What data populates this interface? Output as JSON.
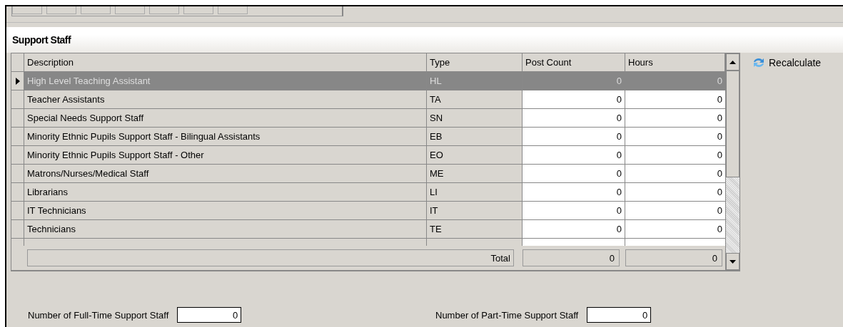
{
  "section": {
    "title": "Support Staff"
  },
  "grid": {
    "columns": [
      "Description",
      "Type",
      "Post Count",
      "Hours"
    ],
    "rows": [
      {
        "description": "High Level Teaching Assistant",
        "type": "HL",
        "post_count": "0",
        "hours": "0",
        "selected": true
      },
      {
        "description": "Teacher Assistants",
        "type": "TA",
        "post_count": "0",
        "hours": "0",
        "selected": false
      },
      {
        "description": "Special Needs Support Staff",
        "type": "SN",
        "post_count": "0",
        "hours": "0",
        "selected": false
      },
      {
        "description": "Minority Ethnic Pupils Support Staff - Bilingual Assistants",
        "type": "EB",
        "post_count": "0",
        "hours": "0",
        "selected": false
      },
      {
        "description": "Minority Ethnic Pupils Support Staff - Other",
        "type": "EO",
        "post_count": "0",
        "hours": "0",
        "selected": false
      },
      {
        "description": "Matrons/Nurses/Medical Staff",
        "type": "ME",
        "post_count": "0",
        "hours": "0",
        "selected": false
      },
      {
        "description": "Librarians",
        "type": "LI",
        "post_count": "0",
        "hours": "0",
        "selected": false
      },
      {
        "description": "IT Technicians",
        "type": "IT",
        "post_count": "0",
        "hours": "0",
        "selected": false
      },
      {
        "description": "Technicians",
        "type": "TE",
        "post_count": "0",
        "hours": "0",
        "selected": false
      }
    ],
    "total": {
      "label": "Total",
      "post_count": "0",
      "hours": "0"
    }
  },
  "recalculate": "Recalculate",
  "fields": [
    {
      "label": "Number of Full-Time Support Staff",
      "value": "0"
    },
    {
      "label": "Number of Part-Time Support Staff",
      "value": "0"
    }
  ]
}
